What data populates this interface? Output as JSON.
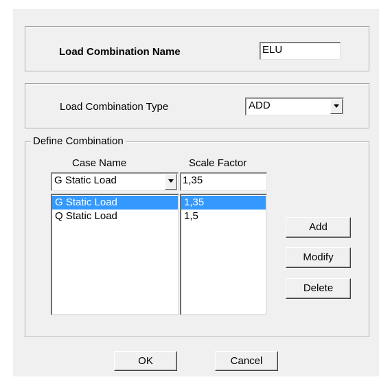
{
  "name_section": {
    "label": "Load Combination Name",
    "value": "ELU"
  },
  "type_section": {
    "label": "Load Combination Type",
    "selected": "ADD"
  },
  "define": {
    "legend": "Define Combination",
    "case_name_header": "Case Name",
    "scale_factor_header": "Scale Factor",
    "case_selected": "G Static Load",
    "scale_input": "1,35",
    "rows": [
      {
        "case": "G Static Load",
        "factor": "1,35",
        "selected": true
      },
      {
        "case": "Q Static Load",
        "factor": "1,5",
        "selected": false
      }
    ],
    "add_label": "Add",
    "modify_label": "Modify",
    "delete_label": "Delete"
  },
  "footer": {
    "ok_label": "OK",
    "cancel_label": "Cancel"
  }
}
